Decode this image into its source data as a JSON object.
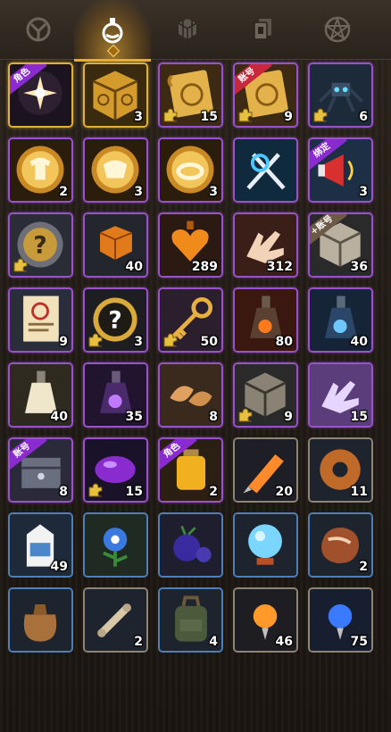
{
  "tabs": [
    {
      "name": "tab-equipment",
      "icon": "armor-icon",
      "active": false
    },
    {
      "name": "tab-consumables",
      "icon": "potion-icon",
      "active": true
    },
    {
      "name": "tab-materials",
      "icon": "cubes-icon",
      "active": false
    },
    {
      "name": "tab-cards",
      "icon": "cards-icon",
      "active": false
    },
    {
      "name": "tab-special",
      "icon": "pentagram-icon",
      "active": false
    }
  ],
  "colors": {
    "accent": "#e8a936",
    "gold": "#e0b13a",
    "purple": "#9a52c9",
    "blue": "#4f7fb8"
  },
  "items": [
    {
      "icon": "dark-star-orb-icon",
      "rarity": "gold",
      "tag": "角色",
      "tagColor": "purple",
      "count": "",
      "puzzle": false
    },
    {
      "icon": "ornate-gold-cube-icon",
      "rarity": "gold",
      "tag": "",
      "count": "3",
      "puzzle": false
    },
    {
      "icon": "golden-scroll-icon",
      "rarity": "purple",
      "tag": "",
      "count": "15",
      "puzzle": true
    },
    {
      "icon": "golden-scroll-icon",
      "rarity": "purple",
      "tag": "账号",
      "tagColor": "red",
      "count": "9",
      "puzzle": true
    },
    {
      "icon": "mech-spider-icon",
      "rarity": "purple",
      "tag": "",
      "count": "6",
      "puzzle": true
    },
    {
      "icon": "glowing-shirt-orb-icon",
      "rarity": "purple",
      "tag": "",
      "count": "2",
      "puzzle": false
    },
    {
      "icon": "glowing-armor-orb-icon",
      "rarity": "purple",
      "tag": "",
      "count": "3",
      "puzzle": false
    },
    {
      "icon": "glowing-ring-orb-icon",
      "rarity": "purple",
      "tag": "",
      "count": "3",
      "puzzle": false
    },
    {
      "icon": "crossed-swords-icon",
      "rarity": "purple",
      "tag": "",
      "count": "",
      "puzzle": false
    },
    {
      "icon": "megaphone-icon",
      "rarity": "purple",
      "tag": "绑定",
      "tagColor": "purple",
      "count": "3",
      "puzzle": false
    },
    {
      "icon": "mystery-medal-icon",
      "rarity": "purple",
      "tag": "",
      "count": "",
      "puzzle": true
    },
    {
      "icon": "orange-block-icon",
      "rarity": "purple",
      "tag": "",
      "count": "40",
      "puzzle": false
    },
    {
      "icon": "heart-potion-icon",
      "rarity": "purple",
      "tag": "",
      "count": "289",
      "puzzle": false
    },
    {
      "icon": "magic-hand-icon",
      "rarity": "purple",
      "tag": "",
      "count": "312",
      "puzzle": false
    },
    {
      "icon": "silver-cube-icon",
      "rarity": "purple",
      "tag": "+账号",
      "tagColor": "gray",
      "count": "36",
      "puzzle": false
    },
    {
      "icon": "poster-icon",
      "rarity": "purple",
      "tag": "",
      "count": "9",
      "puzzle": false
    },
    {
      "icon": "mystery-coin-icon",
      "rarity": "purple",
      "tag": "",
      "count": "3",
      "puzzle": true
    },
    {
      "icon": "golden-key-icon",
      "rarity": "purple",
      "tag": "",
      "count": "50",
      "puzzle": true
    },
    {
      "icon": "fire-bottle-icon",
      "rarity": "purple",
      "tag": "",
      "count": "80",
      "puzzle": false
    },
    {
      "icon": "blue-bottle-icon",
      "rarity": "purple",
      "tag": "",
      "count": "40",
      "puzzle": false
    },
    {
      "icon": "milk-bottle-icon",
      "rarity": "purple",
      "tag": "",
      "count": "40",
      "puzzle": false
    },
    {
      "icon": "purple-bottle-icon",
      "rarity": "purple",
      "tag": "",
      "count": "35",
      "puzzle": false
    },
    {
      "icon": "fortune-cookies-icon",
      "rarity": "purple",
      "tag": "",
      "count": "8",
      "puzzle": false
    },
    {
      "icon": "gray-cube-icon",
      "rarity": "purple",
      "tag": "",
      "count": "9",
      "puzzle": true
    },
    {
      "icon": "ghost-hand-icon",
      "rarity": "purple",
      "tag": "",
      "count": "15",
      "puzzle": false
    },
    {
      "icon": "chained-chest-icon",
      "rarity": "purple",
      "tag": "账号",
      "tagColor": "purple",
      "count": "8",
      "puzzle": false
    },
    {
      "icon": "purple-gem-icon",
      "rarity": "purple",
      "tag": "",
      "count": "15",
      "puzzle": true
    },
    {
      "icon": "yellow-jar-icon",
      "rarity": "purple",
      "tag": "角色",
      "tagColor": "purple",
      "count": "2",
      "puzzle": false
    },
    {
      "icon": "orange-crystal-icon",
      "rarity": "grey",
      "tag": "",
      "count": "20",
      "puzzle": false
    },
    {
      "icon": "donut-icon",
      "rarity": "grey",
      "tag": "",
      "count": "11",
      "puzzle": false
    },
    {
      "icon": "milk-carton-icon",
      "rarity": "blue",
      "tag": "",
      "count": "49",
      "puzzle": false
    },
    {
      "icon": "blue-flower-icon",
      "rarity": "blue",
      "tag": "",
      "count": "",
      "puzzle": false
    },
    {
      "icon": "blueberry-icon",
      "rarity": "blue",
      "tag": "",
      "count": "",
      "puzzle": false
    },
    {
      "icon": "crystal-ball-icon",
      "rarity": "blue",
      "tag": "",
      "count": "",
      "puzzle": false
    },
    {
      "icon": "steak-icon",
      "rarity": "blue",
      "tag": "",
      "count": "2",
      "puzzle": false
    },
    {
      "icon": "sack-icon",
      "rarity": "blue",
      "tag": "",
      "count": "",
      "puzzle": false
    },
    {
      "icon": "scroll-bone-icon",
      "rarity": "grey",
      "tag": "",
      "count": "2",
      "puzzle": false
    },
    {
      "icon": "backpack-icon",
      "rarity": "blue",
      "tag": "",
      "count": "4",
      "puzzle": false
    },
    {
      "icon": "orange-orb-icon",
      "rarity": "grey",
      "tag": "",
      "count": "46",
      "puzzle": false
    },
    {
      "icon": "blue-orb-icon",
      "rarity": "grey",
      "tag": "",
      "count": "75",
      "puzzle": false
    }
  ]
}
